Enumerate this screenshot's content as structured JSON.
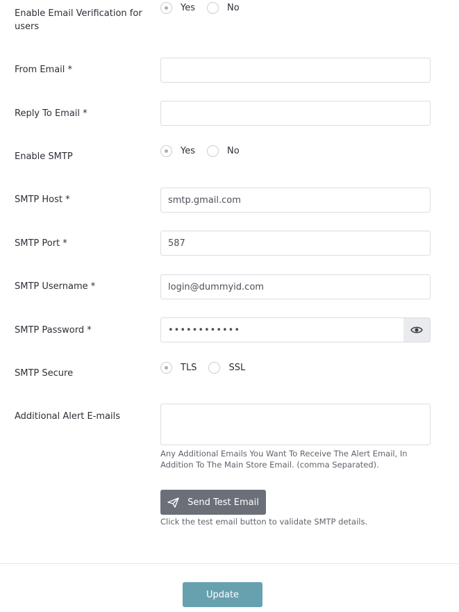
{
  "form": {
    "email_verification": {
      "label": "Enable Email Verification for users",
      "options": [
        "Yes",
        "No"
      ],
      "selected": "Yes"
    },
    "from_email": {
      "label": "From Email *",
      "value": "",
      "placeholder": ""
    },
    "reply_to_email": {
      "label": "Reply To Email *",
      "value": "",
      "placeholder": ""
    },
    "enable_smtp": {
      "label": "Enable SMTP",
      "options": [
        "Yes",
        "No"
      ],
      "selected": "Yes"
    },
    "smtp_host": {
      "label": "SMTP Host *",
      "value": "smtp.gmail.com"
    },
    "smtp_port": {
      "label": "SMTP Port *",
      "value": "587"
    },
    "smtp_username": {
      "label": "SMTP Username *",
      "value": "login@dummyid.com"
    },
    "smtp_password": {
      "label": "SMTP Password *",
      "value": "••••••••••••",
      "toggle_icon": "eye-icon"
    },
    "smtp_secure": {
      "label": "SMTP Secure",
      "options": [
        "TLS",
        "SSL"
      ],
      "selected": "TLS"
    },
    "alert_emails": {
      "label": "Additional Alert E-mails",
      "value": "",
      "help": "Any Additional Emails You Want To Receive The Alert Email, In Addition To The Main Store Email. (comma Separated)."
    },
    "test_email": {
      "button_label": "Send Test Email",
      "icon": "paper-plane-icon",
      "help": "Click the test email button to validate SMTP details."
    },
    "update_label": "Update"
  },
  "colors": {
    "test_button_bg": "#6b7078",
    "update_button_bg": "#67a1b0",
    "input_border": "#d9dce1"
  }
}
